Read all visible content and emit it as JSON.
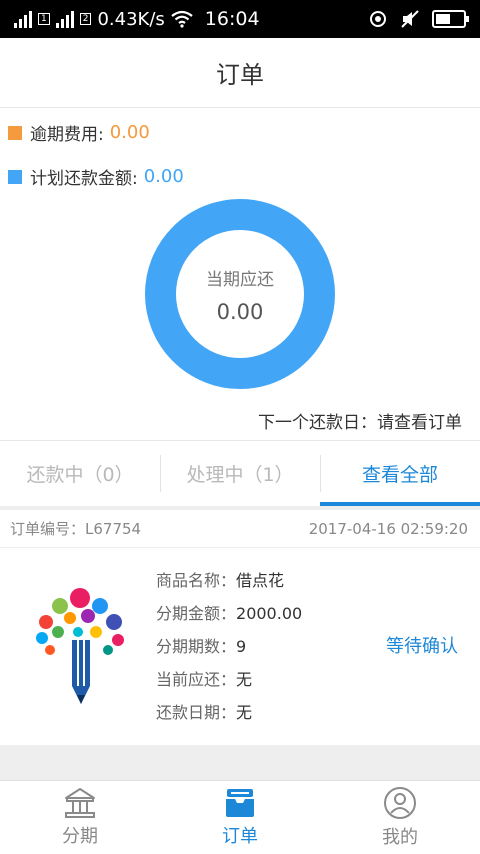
{
  "status_bar": {
    "speed": "0.43K/s",
    "time": "16:04"
  },
  "header": {
    "title": "订单"
  },
  "summary": {
    "overdue_label": "逾期费用:",
    "overdue_value": "0.00",
    "plan_label": "计划还款金额:",
    "plan_value": "0.00",
    "donut_label": "当期应还",
    "donut_value": "0.00",
    "next_due": "下一个还款日：请查看订单"
  },
  "tabs": [
    {
      "label": "还款中（0）"
    },
    {
      "label": "处理中（1）"
    },
    {
      "label": "查看全部"
    }
  ],
  "order": {
    "number_label": "订单编号：",
    "number": "L67754",
    "datetime": "2017-04-16 02:59:20",
    "fields": [
      {
        "k": "商品名称：",
        "v": "借点花"
      },
      {
        "k": "分期金额：",
        "v": "2000.00"
      },
      {
        "k": "分期期数：",
        "v": "9"
      },
      {
        "k": "当前应还：",
        "v": "无"
      },
      {
        "k": "还款日期：",
        "v": "无"
      }
    ],
    "status": "等待确认"
  },
  "bottom_nav": [
    {
      "label": "分期",
      "icon": "bank-icon"
    },
    {
      "label": "订单",
      "icon": "inbox-icon"
    },
    {
      "label": "我的",
      "icon": "user-icon"
    }
  ],
  "colors": {
    "accent": "#1e88d8",
    "donut": "#42a5f5",
    "overdue": "#f59a3d",
    "plan": "#42a5f5"
  }
}
